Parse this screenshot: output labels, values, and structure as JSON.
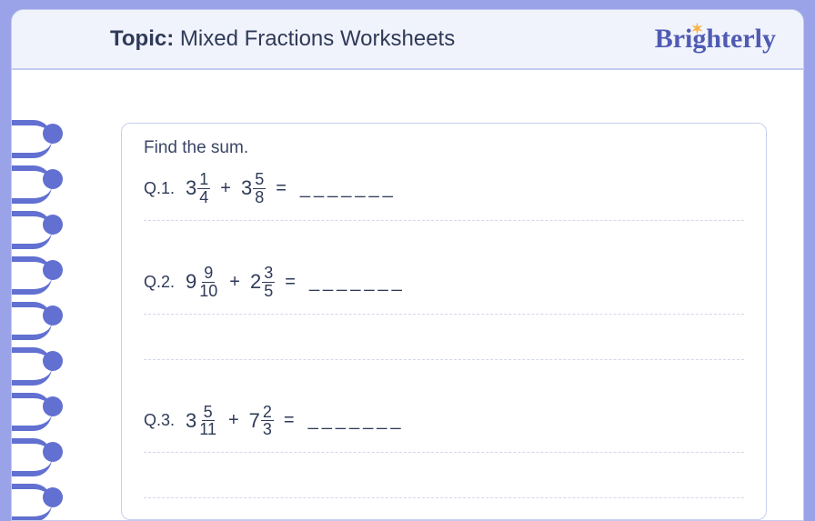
{
  "header": {
    "topic_label": "Topic:",
    "topic_title": "Mixed Fractions Worksheets",
    "brand": "Brighterly"
  },
  "worksheet": {
    "instruction": "Find the sum.",
    "blank": "_______",
    "questions": [
      {
        "label": "Q.1.",
        "term1": {
          "whole": "3",
          "num": "1",
          "den": "4"
        },
        "op": "+",
        "term2": {
          "whole": "3",
          "num": "5",
          "den": "8"
        }
      },
      {
        "label": "Q.2.",
        "term1": {
          "whole": "9",
          "num": "9",
          "den": "10"
        },
        "op": "+",
        "term2": {
          "whole": "2",
          "num": "3",
          "den": "5"
        }
      },
      {
        "label": "Q.3.",
        "term1": {
          "whole": "3",
          "num": "5",
          "den": "11"
        },
        "op": "+",
        "term2": {
          "whole": "7",
          "num": "2",
          "den": "3"
        }
      }
    ]
  }
}
